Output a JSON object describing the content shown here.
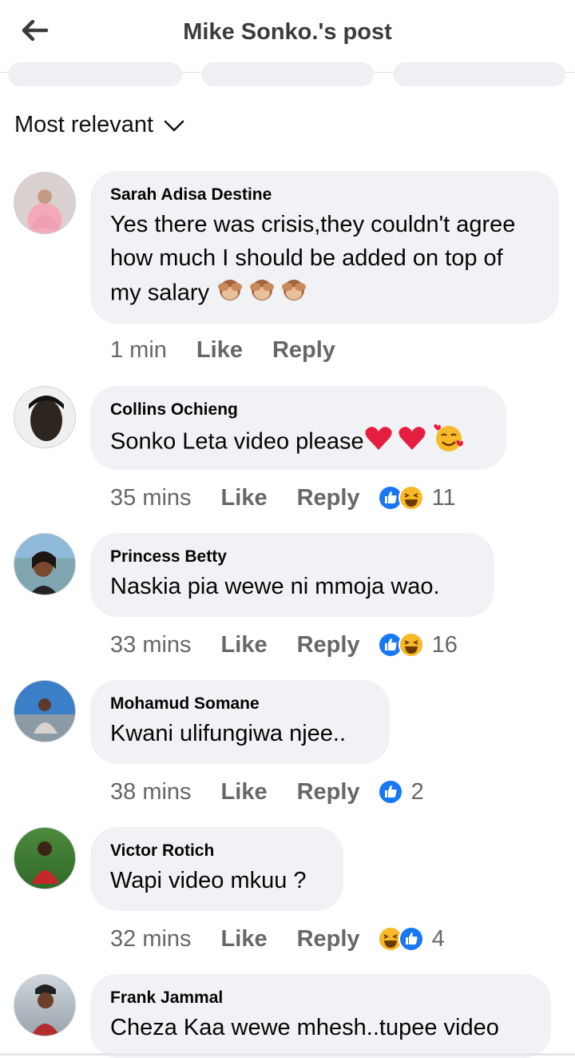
{
  "header": {
    "title": "Mike Sonko.'s post",
    "back_icon": "arrow-left-icon"
  },
  "sort": {
    "label": "Most relevant"
  },
  "colors": {
    "like_blue": "#1877f2",
    "haha_yellow": "#f7b928",
    "heart_red": "#e41e3f",
    "bubble": "#f0f2f5",
    "meta": "#65676b"
  },
  "comments": [
    {
      "author": "Sarah Adisa Destine",
      "text": "Yes there was crisis,they couldn't agree how much I should be added on top of my salary",
      "emojis": "see-no-evil-monkey x3",
      "time": "1 min",
      "like": "Like",
      "reply": "Reply",
      "reactions": [],
      "count": ""
    },
    {
      "author": "Collins Ochieng",
      "text": "Sonko Leta video please",
      "emojis": "red-heart x2, smiling-face-with-hearts",
      "time": "35 mins",
      "like": "Like",
      "reply": "Reply",
      "reactions": [
        "like",
        "haha"
      ],
      "count": "11"
    },
    {
      "author": "Princess Betty",
      "text": "Naskia pia wewe ni mmoja wao.",
      "time": "33 mins",
      "like": "Like",
      "reply": "Reply",
      "reactions": [
        "like",
        "haha"
      ],
      "count": "16"
    },
    {
      "author": "Mohamud Somane",
      "text": "Kwani ulifungiwa njee..",
      "time": "38 mins",
      "like": "Like",
      "reply": "Reply",
      "reactions": [
        "like"
      ],
      "count": "2"
    },
    {
      "author": "Victor Rotich",
      "text": "Wapi video mkuu ?",
      "time": "32 mins",
      "like": "Like",
      "reply": "Reply",
      "reactions": [
        "haha",
        "like"
      ],
      "count": "4"
    },
    {
      "author": "Frank Jammal",
      "text": "Cheza Kaa wewe mhesh..tupee video"
    }
  ]
}
